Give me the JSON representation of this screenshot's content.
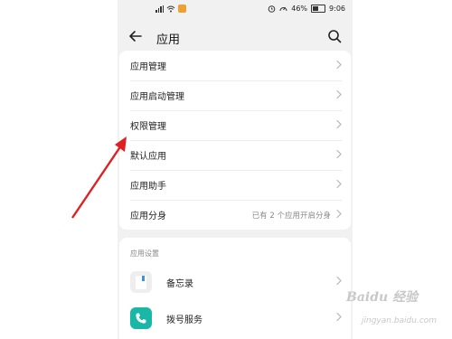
{
  "status_bar": {
    "battery_text": "46%",
    "time": "9:06",
    "battery_level": 0.46
  },
  "header": {
    "title": "应用"
  },
  "menu": {
    "items": [
      {
        "label": "应用管理",
        "value": ""
      },
      {
        "label": "应用启动管理",
        "value": ""
      },
      {
        "label": "权限管理",
        "value": ""
      },
      {
        "label": "默认应用",
        "value": ""
      },
      {
        "label": "应用助手",
        "value": ""
      },
      {
        "label": "应用分身",
        "value": "已有 2 个应用开启分身"
      }
    ]
  },
  "settings": {
    "section_title": "应用设置",
    "apps": [
      {
        "label": "备忘录",
        "icon": "memo-icon"
      },
      {
        "label": "拨号服务",
        "icon": "phone-icon"
      }
    ]
  },
  "colors": {
    "arrow": "#e02020",
    "phone_app": "#18b7a6"
  }
}
